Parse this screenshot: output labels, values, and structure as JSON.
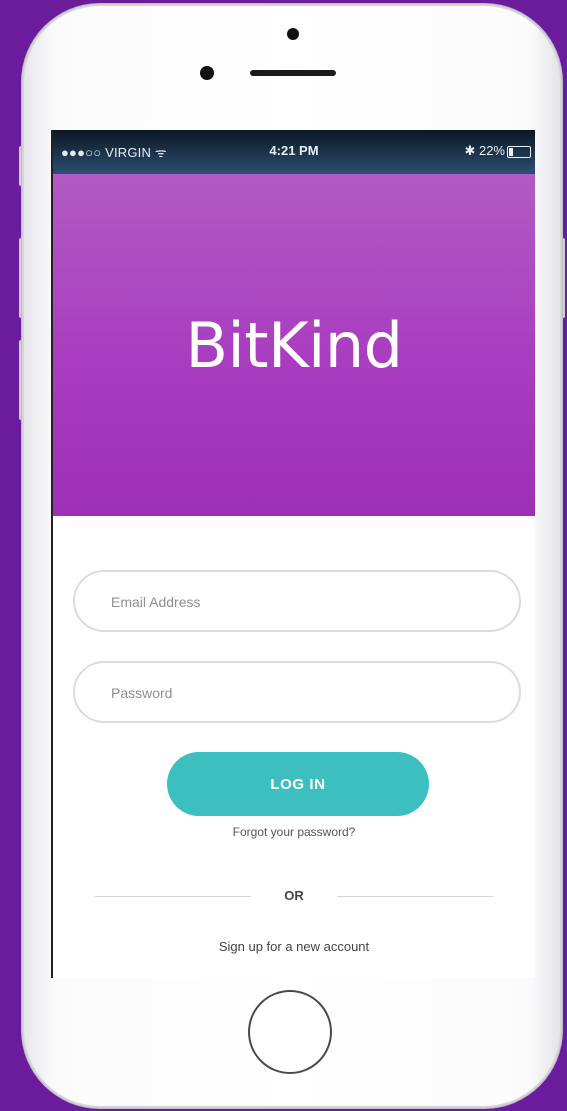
{
  "statusbar": {
    "carrier": "●●●○○ VIRGIN ᯤ",
    "time": "4:21 PM",
    "battery_text": "✱ 22%",
    "battery_level": 0.22
  },
  "app": {
    "title": "BitKind"
  },
  "form": {
    "email_placeholder": "Email Address",
    "password_placeholder": "Password",
    "login_label": "LOG IN",
    "forgot_label": "Forgot your password?",
    "or_label": "OR",
    "signup_label": "Sign up for a new account"
  },
  "colors": {
    "background": "#6b1c9c",
    "header_top": "#b25ac4",
    "header_bottom": "#9e2fb7",
    "accent": "#3cbfbe"
  }
}
